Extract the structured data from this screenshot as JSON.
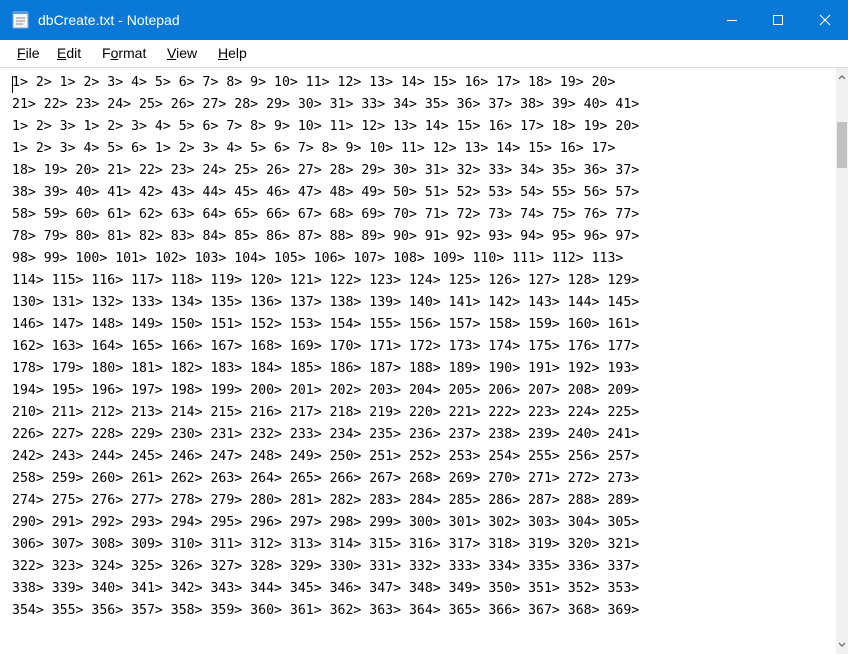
{
  "window": {
    "title": "dbCreate.txt - Notepad",
    "title_bg": "#0a78d7",
    "app_icon": "notepad-icon",
    "controls": [
      "minimize-icon",
      "maximize-icon",
      "close-icon"
    ]
  },
  "menu": {
    "items": [
      {
        "accel": "F",
        "rest": "ile"
      },
      {
        "accel": "E",
        "rest": "dit"
      },
      {
        "pre": "F",
        "accel": "o",
        "rest": "rmat"
      },
      {
        "accel": "V",
        "rest": "iew"
      },
      {
        "accel": "H",
        "rest": "elp"
      }
    ]
  },
  "editor": {
    "lines": [
      "1> 2> 1> 2> 3> 4> 5> 6> 7> 8> 9> 10> 11> 12> 13> 14> 15> 16> 17> 18> 19> 20>",
      "21> 22> 23> 24> 25> 26> 27> 28> 29> 30> 31> 33> 34> 35> 36> 37> 38> 39> 40> 41>",
      "1> 2> 3> 1> 2> 3> 4> 5> 6> 7> 8> 9> 10> 11> 12> 13> 14> 15> 16> 17> 18> 19> 20>",
      "1> 2> 3> 4> 5> 6> 1> 2> 3> 4> 5> 6> 7> 8> 9> 10> 11> 12> 13> 14> 15> 16> 17>",
      "18> 19> 20> 21> 22> 23> 24> 25> 26> 27> 28> 29> 30> 31> 32> 33> 34> 35> 36> 37>",
      "38> 39> 40> 41> 42> 43> 44> 45> 46> 47> 48> 49> 50> 51> 52> 53> 54> 55> 56> 57>",
      "58> 59> 60> 61> 62> 63> 64> 65> 66> 67> 68> 69> 70> 71> 72> 73> 74> 75> 76> 77>",
      "78> 79> 80> 81> 82> 83> 84> 85> 86> 87> 88> 89> 90> 91> 92> 93> 94> 95> 96> 97>",
      "98> 99> 100> 101> 102> 103> 104> 105> 106> 107> 108> 109> 110> 111> 112> 113>",
      "114> 115> 116> 117> 118> 119> 120> 121> 122> 123> 124> 125> 126> 127> 128> 129>",
      "130> 131> 132> 133> 134> 135> 136> 137> 138> 139> 140> 141> 142> 143> 144> 145>",
      "146> 147> 148> 149> 150> 151> 152> 153> 154> 155> 156> 157> 158> 159> 160> 161>",
      "162> 163> 164> 165> 166> 167> 168> 169> 170> 171> 172> 173> 174> 175> 176> 177>",
      "178> 179> 180> 181> 182> 183> 184> 185> 186> 187> 188> 189> 190> 191> 192> 193>",
      "194> 195> 196> 197> 198> 199> 200> 201> 202> 203> 204> 205> 206> 207> 208> 209>",
      "210> 211> 212> 213> 214> 215> 216> 217> 218> 219> 220> 221> 222> 223> 224> 225>",
      "226> 227> 228> 229> 230> 231> 232> 233> 234> 235> 236> 237> 238> 239> 240> 241>",
      "242> 243> 244> 245> 246> 247> 248> 249> 250> 251> 252> 253> 254> 255> 256> 257>",
      "258> 259> 260> 261> 262> 263> 264> 265> 266> 267> 268> 269> 270> 271> 272> 273>",
      "274> 275> 276> 277> 278> 279> 280> 281> 282> 283> 284> 285> 286> 287> 288> 289>",
      "290> 291> 292> 293> 294> 295> 296> 297> 298> 299> 300> 301> 302> 303> 304> 305>",
      "306> 307> 308> 309> 310> 311> 312> 313> 314> 315> 316> 317> 318> 319> 320> 321>",
      "322> 323> 324> 325> 326> 327> 328> 329> 330> 331> 332> 333> 334> 335> 336> 337>",
      "338> 339> 340> 341> 342> 343> 344> 345> 346> 347> 348> 349> 350> 351> 352> 353>",
      "354> 355> 356> 357> 358> 359> 360> 361> 362> 363> 364> 365> 366> 367> 368> 369>"
    ]
  },
  "scrollbar": {
    "icons": [
      "scroll-up-arrow-icon",
      "scroll-down-arrow-icon"
    ]
  }
}
